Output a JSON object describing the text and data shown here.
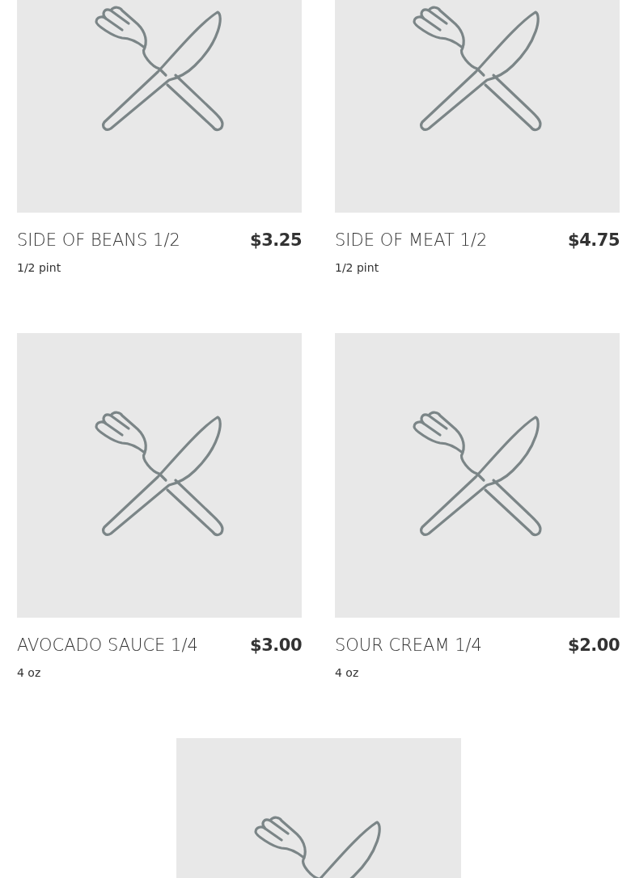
{
  "items": [
    {
      "kind": "placeholder",
      "name": "SIDE OF BEANS 1/2",
      "price": "$3.25",
      "description": "1/2 pint"
    },
    {
      "kind": "placeholder",
      "name": "SIDE OF MEAT 1/2",
      "price": "$4.75",
      "description": "1/2 pint"
    },
    {
      "kind": "placeholder",
      "name": "AVOCADO SAUCE 1/4",
      "price": "$3.00",
      "description": "4 oz"
    },
    {
      "kind": "placeholder",
      "name": "SOUR CREAM 1/4",
      "price": "$2.00",
      "description": "4 oz"
    },
    {
      "kind": "placeholder"
    }
  ]
}
